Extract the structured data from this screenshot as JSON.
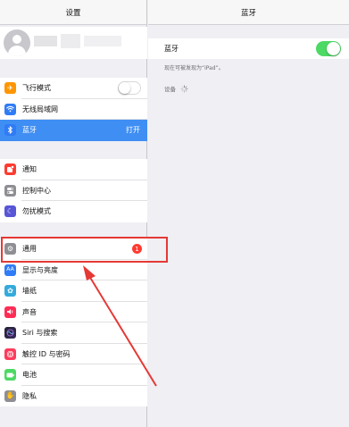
{
  "left_panel": {
    "title": "设置",
    "group1": [
      {
        "label": "飞行模式",
        "icon": "airplane-icon",
        "color": "#ff9500",
        "control": "toggle-off"
      },
      {
        "label": "无线局域网",
        "icon": "wifi-icon",
        "color": "#2f7cf6"
      },
      {
        "label": "蓝牙",
        "icon": "bluetooth-icon",
        "color": "#2f7cf6",
        "value": "打开",
        "selected": true
      }
    ],
    "group2": [
      {
        "label": "通知",
        "icon": "notifications-icon",
        "color": "#ff3b30"
      },
      {
        "label": "控制中心",
        "icon": "control-center-icon",
        "color": "#8e8e93"
      },
      {
        "label": "勿扰模式",
        "icon": "moon-icon",
        "color": "#5856d6"
      }
    ],
    "group3": [
      {
        "label": "通用",
        "icon": "gear-icon",
        "color": "#8e8e93",
        "badge": "1"
      },
      {
        "label": "显示与亮度",
        "icon": "display-brightness-icon",
        "color": "#2f7cf6"
      },
      {
        "label": "墙纸",
        "icon": "wallpaper-icon",
        "color": "#34aadc"
      },
      {
        "label": "声音",
        "icon": "speaker-icon",
        "color": "#ff2d55"
      },
      {
        "label": "Siri 与搜索",
        "icon": "siri-icon",
        "color": "#222233"
      },
      {
        "label": "触控 ID 与密码",
        "icon": "fingerprint-icon",
        "color": "#ff3b5c"
      },
      {
        "label": "电池",
        "icon": "battery-icon",
        "color": "#4cd964"
      },
      {
        "label": "隐私",
        "icon": "hand-icon",
        "color": "#8e8e93"
      }
    ]
  },
  "right_panel": {
    "title": "蓝牙",
    "bluetooth_label": "蓝牙",
    "bluetooth_on": true,
    "discoverable_hint": "现在可被发现为“iPad”。",
    "devices_label": "设备"
  },
  "annotation": {
    "highlight_color": "#e53935",
    "points_to": "通用"
  }
}
